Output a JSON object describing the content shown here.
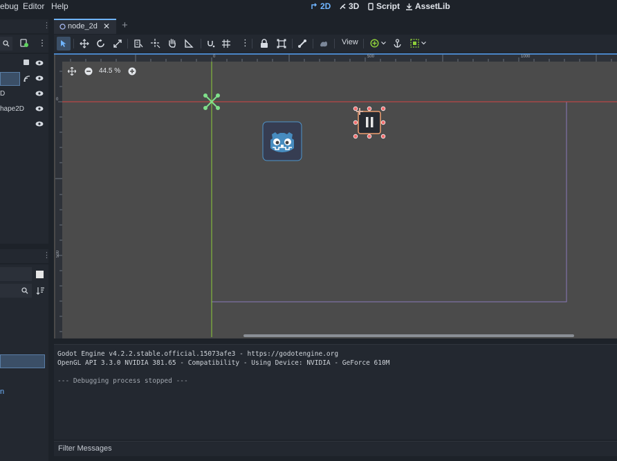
{
  "menubar": {
    "items": [
      "ebug",
      "Editor",
      "Help"
    ],
    "workspaces": [
      {
        "label": "2D",
        "active": true
      },
      {
        "label": "3D",
        "active": false
      },
      {
        "label": "Script",
        "active": false
      },
      {
        "label": "AssetLib",
        "active": false
      }
    ]
  },
  "scene_tree": {
    "nodes": [
      "",
      "D",
      "hape2D",
      ""
    ]
  },
  "filesystem": {
    "link_fragment": "n"
  },
  "tabs": {
    "scene_tab": "node_2d",
    "add_tab": "+"
  },
  "toolbar": {
    "view_label": "View"
  },
  "viewport": {
    "zoom_label": "44.5 %",
    "ruler_top": [
      "0",
      "500",
      "1000"
    ],
    "ruler_left": [
      "0",
      "500"
    ]
  },
  "output": {
    "lines": [
      "Godot Engine v4.2.2.stable.official.15073afe3 - https://godotengine.org",
      "OpenGL API 3.3.0 NVIDIA 381.65 - Compatibility - Using Device: NVIDIA - GeForce 610M",
      "",
      "--- Debugging process stopped ---"
    ],
    "filter_placeholder": "Filter Messages"
  },
  "colors": {
    "accent": "#70b5ff",
    "viewport_bg": "#4b4b4b",
    "origin_x_axis": "#d64545",
    "origin_y_axis": "#8ecf3a",
    "selection": "#f06c6c",
    "screen_rect": "#8a7ab8"
  }
}
